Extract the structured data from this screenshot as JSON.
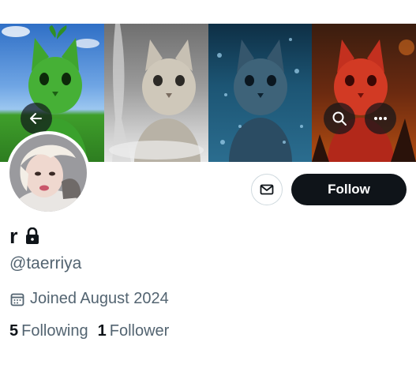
{
  "profile": {
    "display_name": "r",
    "handle": "@taerriya",
    "joined": "Joined August 2024",
    "following_count": "5",
    "following_label": "Following",
    "followers_count": "1",
    "followers_label": "Follower",
    "protected": true
  },
  "actions": {
    "follow_label": "Follow"
  },
  "icons": {
    "back": "arrow-left-icon",
    "search": "search-icon",
    "more": "more-horizontal-icon",
    "message": "envelope-icon",
    "lock": "lock-icon",
    "calendar": "calendar-icon"
  },
  "colors": {
    "text_primary": "#0f1419",
    "text_secondary": "#536471",
    "follow_button_bg": "#0f1419",
    "follow_button_text": "#ffffff",
    "header_button_bg": "rgba(15,20,25,0.70)"
  }
}
